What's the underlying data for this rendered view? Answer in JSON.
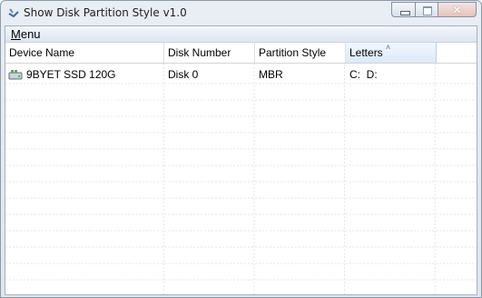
{
  "window": {
    "title": "Show Disk Partition Style v1.0",
    "close_glyph": "✕"
  },
  "menu": {
    "label_accel": "M",
    "label_rest": "enu"
  },
  "columns": {
    "device_name": "Device Name",
    "disk_number": "Disk Number",
    "partition_style": "Partition Style",
    "letters": "Letters",
    "sort_indicator": "˄"
  },
  "rows": [
    {
      "device_name": "9BYET SSD 120G",
      "disk_number": "Disk 0",
      "partition_style": "MBR",
      "letters": "C:  D:"
    }
  ],
  "icons": {
    "app": "disk-partition-app-icon",
    "drive": "hard-drive-icon"
  },
  "colors": {
    "sorted_header": "#dbeaf8",
    "close_button": "#e5c2bb"
  }
}
